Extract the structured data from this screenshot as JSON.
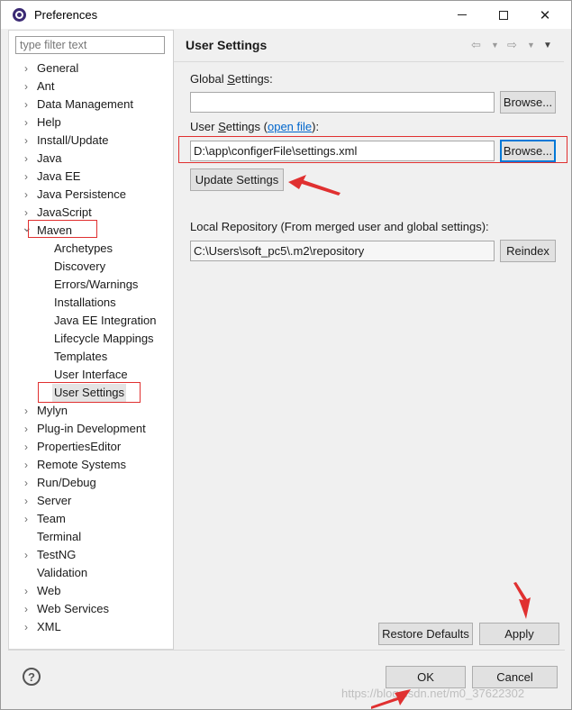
{
  "window": {
    "title": "Preferences",
    "minimize_glyph": "—",
    "close_glyph": "✕"
  },
  "filter": {
    "placeholder": "type filter text",
    "value": ""
  },
  "tree": [
    {
      "label": "General",
      "expanded": false,
      "level": 0
    },
    {
      "label": "Ant",
      "expanded": false,
      "level": 0
    },
    {
      "label": "Data Management",
      "expanded": false,
      "level": 0
    },
    {
      "label": "Help",
      "expanded": false,
      "level": 0
    },
    {
      "label": "Install/Update",
      "expanded": false,
      "level": 0
    },
    {
      "label": "Java",
      "expanded": false,
      "level": 0
    },
    {
      "label": "Java EE",
      "expanded": false,
      "level": 0
    },
    {
      "label": "Java Persistence",
      "expanded": false,
      "level": 0
    },
    {
      "label": "JavaScript",
      "expanded": false,
      "level": 0
    },
    {
      "label": "Maven",
      "expanded": true,
      "level": 0
    },
    {
      "label": "Archetypes",
      "level": 1
    },
    {
      "label": "Discovery",
      "level": 1
    },
    {
      "label": "Errors/Warnings",
      "level": 1
    },
    {
      "label": "Installations",
      "level": 1
    },
    {
      "label": "Java EE Integration",
      "level": 1
    },
    {
      "label": "Lifecycle Mappings",
      "level": 1
    },
    {
      "label": "Templates",
      "level": 1
    },
    {
      "label": "User Interface",
      "level": 1
    },
    {
      "label": "User Settings",
      "level": 1,
      "selected": true
    },
    {
      "label": "Mylyn",
      "expanded": false,
      "level": 0
    },
    {
      "label": "Plug-in Development",
      "expanded": false,
      "level": 0
    },
    {
      "label": "PropertiesEditor",
      "expanded": false,
      "level": 0
    },
    {
      "label": "Remote Systems",
      "expanded": false,
      "level": 0
    },
    {
      "label": "Run/Debug",
      "expanded": false,
      "level": 0
    },
    {
      "label": "Server",
      "expanded": false,
      "level": 0
    },
    {
      "label": "Team",
      "expanded": false,
      "level": 0
    },
    {
      "label": "Terminal",
      "level": 0,
      "leaf": true
    },
    {
      "label": "TestNG",
      "expanded": false,
      "level": 0
    },
    {
      "label": "Validation",
      "level": 0,
      "leaf": true
    },
    {
      "label": "Web",
      "expanded": false,
      "level": 0
    },
    {
      "label": "Web Services",
      "expanded": false,
      "level": 0
    },
    {
      "label": "XML",
      "expanded": false,
      "level": 0
    }
  ],
  "page": {
    "title": "User Settings",
    "global_settings_label_pre": "Global ",
    "global_settings_label_accel": "S",
    "global_settings_label_post": "ettings:",
    "global_settings_value": "",
    "browse_label": "Browse...",
    "user_settings_label_pre": "User ",
    "user_settings_label_accel": "S",
    "user_settings_label_post": "ettings (",
    "open_file_link": "open file",
    "user_settings_label_end": "):",
    "user_settings_value": "D:\\app\\configerFile\\settings.xml",
    "update_settings_label": "Update Settings",
    "local_repo_label": "Local Repository (From merged user and global settings):",
    "local_repo_value": "C:\\Users\\soft_pc5\\.m2\\repository",
    "reindex_label": "Reindex",
    "restore_defaults_label": "Restore Defaults",
    "apply_label": "Apply"
  },
  "footer": {
    "help_glyph": "?",
    "ok_label": "OK",
    "cancel_label": "Cancel"
  },
  "watermark": "https://blog.csdn.net/m0_37622302",
  "annotation_color": "#e03030"
}
